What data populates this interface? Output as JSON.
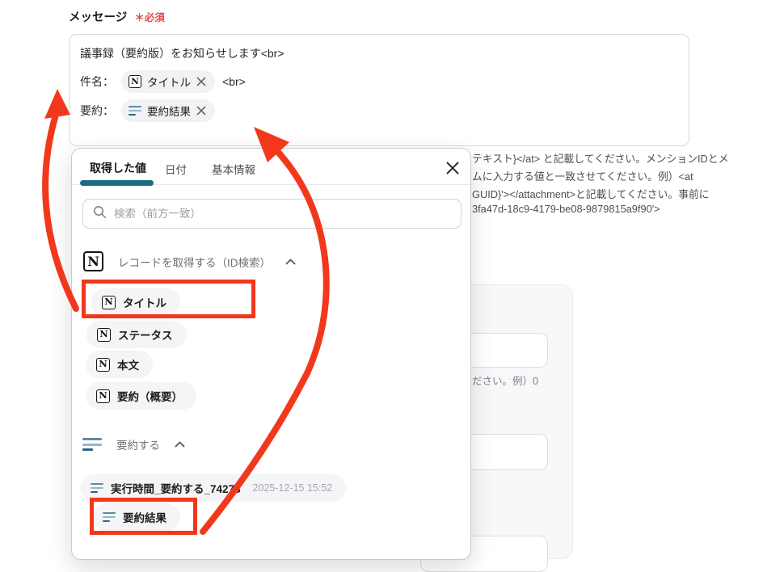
{
  "colors": {
    "accent_teal": "#1d6b80",
    "annotation_red": "#f2381c",
    "required_red": "#e5484d"
  },
  "message_field": {
    "label": "メッセージ",
    "required": "＊必須",
    "line1": "議事録（要約版）をお知らせします<br>",
    "line2": {
      "prefix": "件名：",
      "chip": "タイトル",
      "suffix": "<br>"
    },
    "line3": {
      "prefix": "要約：",
      "chip": "要約結果"
    }
  },
  "hint_text": {
    "lines": [
      "テキスト}</at> と記載してください。メンションIDとメ",
      "ムに入力する値と一致させてください。例）<at",
      "GUID}'></attachment>と記載してください。事前に",
      "3fa47d-18c9-4179-be08-9879815a9f90'>"
    ]
  },
  "side_panel": {
    "caption": "ださい。例）0"
  },
  "popup": {
    "tabs": [
      {
        "label": "取得した値"
      },
      {
        "label": "日付"
      },
      {
        "label": "基本情報"
      }
    ],
    "search": {
      "placeholder": "検索（前方一致）"
    },
    "sections": [
      {
        "title": "レコードを取得する（ID検索）",
        "chips": [
          {
            "label": "タイトル"
          },
          {
            "label": "ステータス"
          },
          {
            "label": "本文"
          },
          {
            "label": "要約（概要）"
          }
        ]
      },
      {
        "title": "要約する",
        "chips": [
          {
            "label": "実行時間_要約する_74278",
            "timestamp": "2025-12-15 15:52"
          },
          {
            "label": "要約結果"
          }
        ]
      }
    ]
  }
}
